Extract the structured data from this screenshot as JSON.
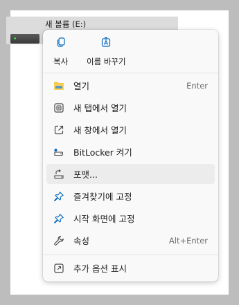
{
  "drive": {
    "name": "새 볼륨 (E:)"
  },
  "colors": {
    "accent": "#0067c0",
    "folder": "#f7c843",
    "hover": "#ececec"
  },
  "menu": {
    "top_actions": [
      {
        "label": "복사",
        "icon": "copy-icon"
      },
      {
        "label": "이름 바꾸기",
        "icon": "rename-icon"
      }
    ],
    "items": [
      {
        "label": "열기",
        "shortcut": "Enter",
        "icon": "folder-icon"
      },
      {
        "label": "새 탭에서 열기",
        "shortcut": "",
        "icon": "new-tab-icon"
      },
      {
        "label": "새 창에서 열기",
        "shortcut": "",
        "icon": "new-window-icon"
      },
      {
        "label": "BitLocker 켜기",
        "shortcut": "",
        "icon": "bitlocker-key-icon"
      },
      {
        "label": "포맷...",
        "shortcut": "",
        "icon": "format-drive-icon",
        "highlighted": true
      },
      {
        "label": "즐겨찾기에 고정",
        "shortcut": "",
        "icon": "pin-icon"
      },
      {
        "label": "시작 화면에 고정",
        "shortcut": "",
        "icon": "pin-icon"
      },
      {
        "label": "속성",
        "shortcut": "Alt+Enter",
        "icon": "wrench-icon"
      },
      {
        "label": "추가 옵션 표시",
        "shortcut": "",
        "icon": "show-more-options-icon"
      }
    ]
  }
}
